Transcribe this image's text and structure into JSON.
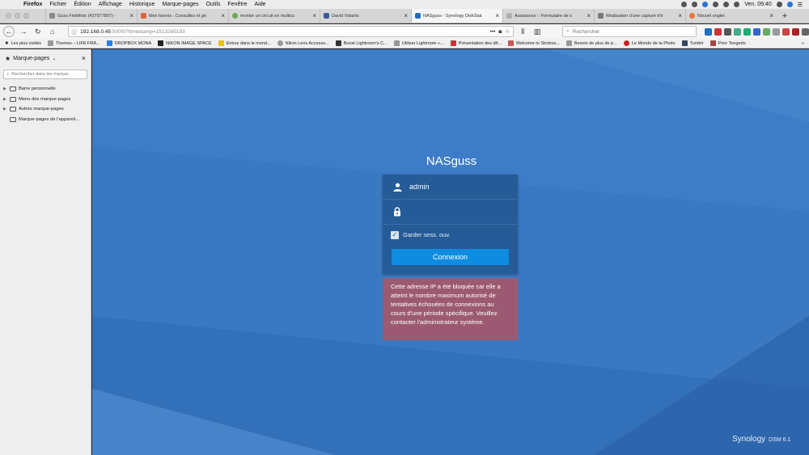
{
  "menubar": {
    "app": "Firefox",
    "items": [
      "Fichier",
      "Édition",
      "Affichage",
      "Historique",
      "Marque-pages",
      "Outils",
      "Fenêtre",
      "Aide"
    ],
    "clock": "Ven. 09:40"
  },
  "tabs": [
    {
      "label": "Guss Fédéfoto (437977807) -"
    },
    {
      "label": "Mes favoris : Consultez et gé"
    },
    {
      "label": "monter un circuit en multicu"
    },
    {
      "label": "David Volants"
    },
    {
      "label": "NASguss - Synology DiskStat"
    },
    {
      "label": "Assistance :: Formulaire de s"
    },
    {
      "label": "Réalisation d'une capture d'é"
    },
    {
      "label": "Nouvel onglet"
    }
  ],
  "navbar": {
    "url_host": "192.168.0.45",
    "url_path": ":5000/?timestamp=1513265193",
    "search_placeholder": "Rechercher",
    "more": "•••"
  },
  "bookmarks": [
    "Les plus visités",
    "Themes – LIFE FRA...",
    "DROPBOX MONA",
    "NIKON IMAGE SPACE",
    "Entrez dans le mond...",
    "Nikon Lens Accesso...",
    "Boost Lightroom's C...",
    "Utiliser Lightroom «...",
    "Présentation des dif...",
    "Welcome to Strobox...",
    "Besoin de plus de p...",
    "Le Monde de la Photo",
    "Tumblr",
    "Prior Tongerlo"
  ],
  "sidebar": {
    "title": "Marque-pages",
    "search_placeholder": "Rechercher dans les marque",
    "items": [
      {
        "label": "Barre personnelle"
      },
      {
        "label": "Menu des marque-pages"
      },
      {
        "label": "Autres marque-pages"
      },
      {
        "label": "Marque-pages de l'appareil..."
      }
    ]
  },
  "login": {
    "server_name": "NASguss",
    "username": "admin",
    "remember_label": "Garder sess. ouv.",
    "submit_label": "Connexion",
    "error_message": "Cette adresse IP a été bloquée car elle a atteint le nombre maximum autorisé de tentatives échouées de connexions au cours d'une période spécifique. Veuillez contacter l'administrateur système."
  },
  "brand": {
    "name": "Synology",
    "version": "DSM 6.1"
  },
  "colors": {
    "background": "#3a79c2",
    "panel": "#255b97",
    "button": "#0e8ce0",
    "error": "#9c5a72"
  }
}
